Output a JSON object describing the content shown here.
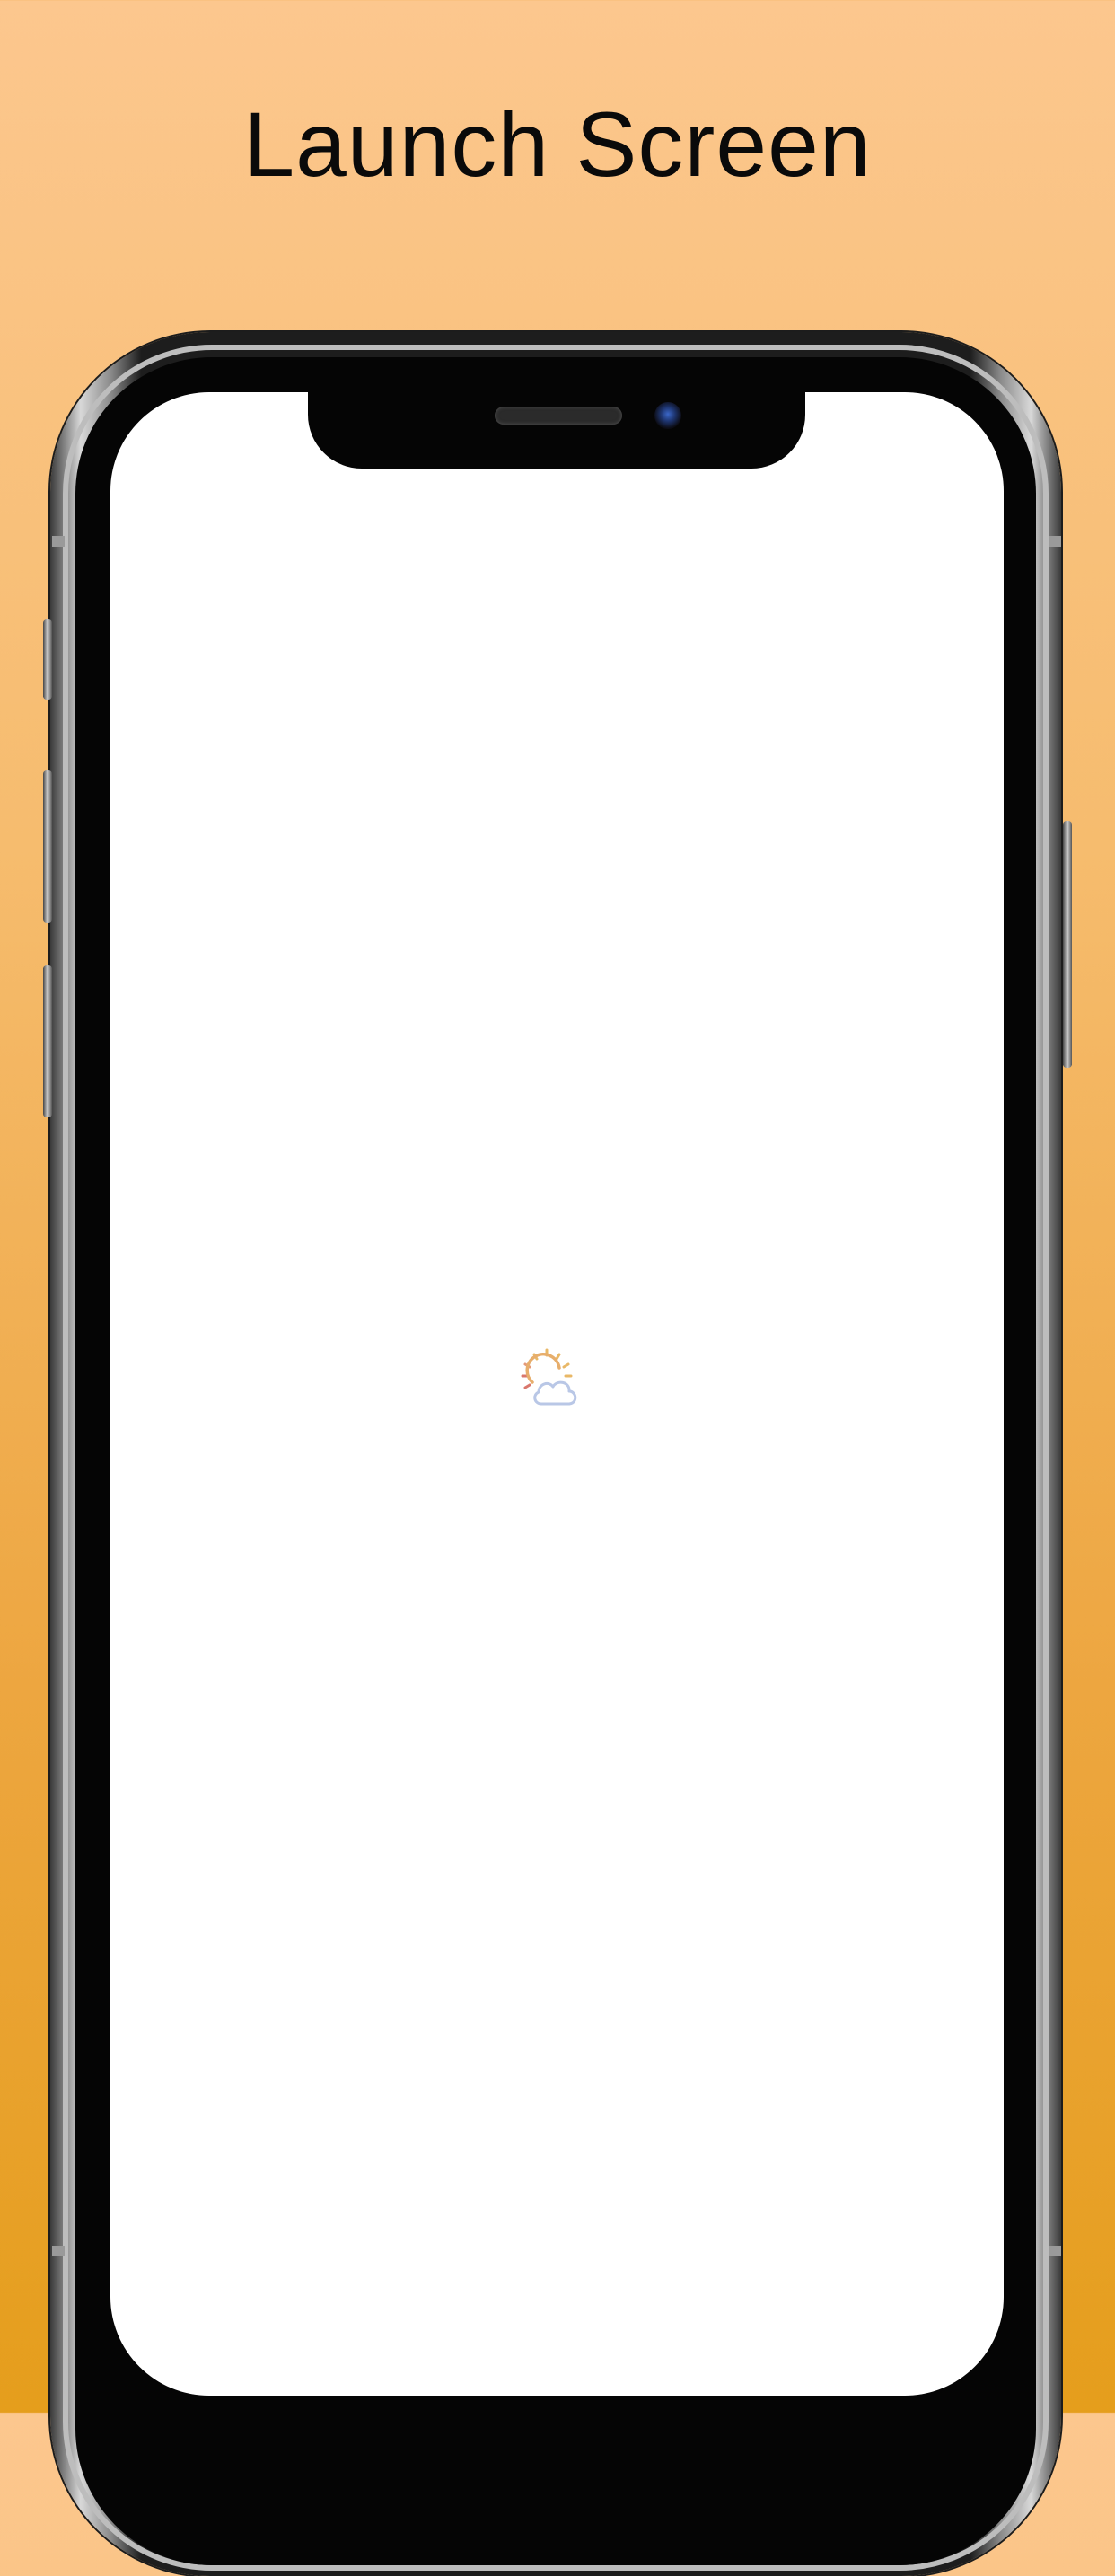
{
  "page": {
    "headline": "Launch Screen"
  },
  "colors": {
    "background_top": "#FCC78E",
    "background_bottom": "#E59E1C",
    "screen": "#FFFFFF",
    "bezel": "#050505"
  },
  "icons": {
    "launch_icon": "partly-cloudy-sun-icon"
  }
}
